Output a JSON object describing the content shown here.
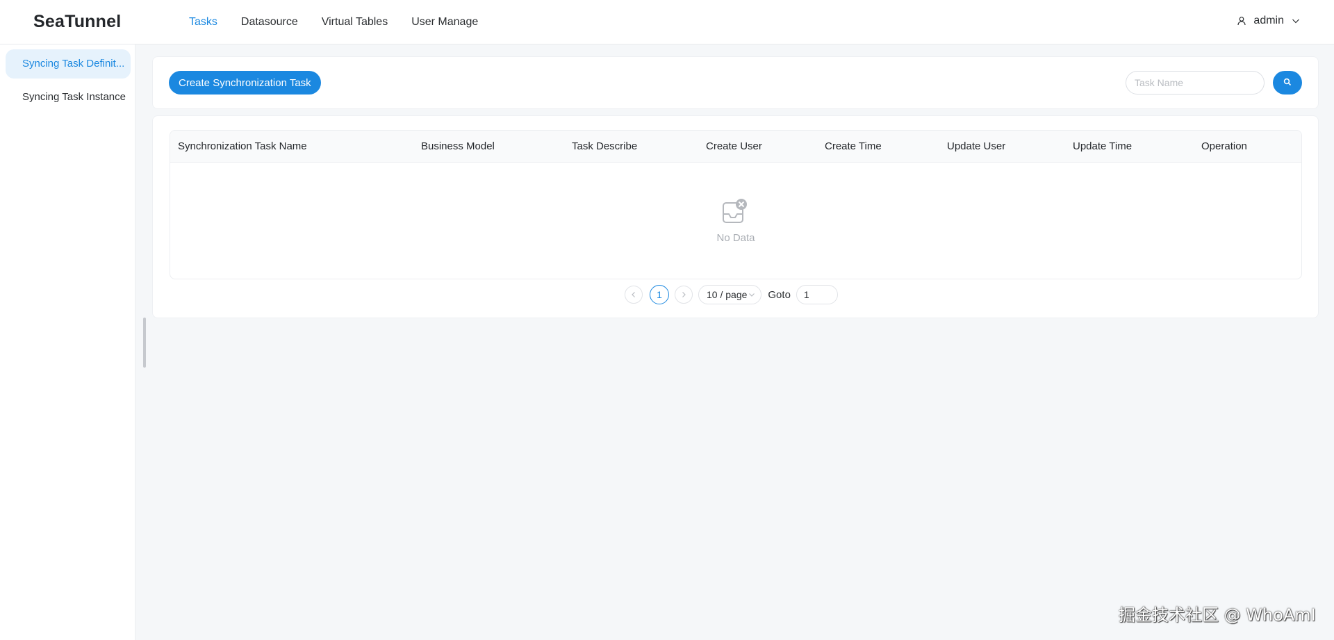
{
  "app": {
    "logo": "SeaTunnel"
  },
  "nav": {
    "items": [
      {
        "label": "Tasks",
        "active": true
      },
      {
        "label": "Datasource"
      },
      {
        "label": "Virtual Tables"
      },
      {
        "label": "User Manage"
      }
    ]
  },
  "user": {
    "name": "admin",
    "icon": "user-icon"
  },
  "sidebar": {
    "items": [
      {
        "label": "Syncing Task Definit...",
        "active": true
      },
      {
        "label": "Syncing Task Instance"
      }
    ]
  },
  "toolbar": {
    "create_label": "Create Synchronization Task",
    "search_placeholder": "Task Name",
    "search_icon": "search-icon"
  },
  "table": {
    "columns": [
      "Synchronization Task Name",
      "Business Model",
      "Task Describe",
      "Create User",
      "Create Time",
      "Update User",
      "Update Time",
      "Operation"
    ],
    "rows": [],
    "empty_text": "No Data"
  },
  "pagination": {
    "current_page": "1",
    "page_size": "10 / page",
    "goto_label": "Goto",
    "goto_value": "1"
  },
  "colors": {
    "accent": "#1b88e0",
    "background": "#f5f7f9",
    "sidebar_active_bg": "#e6f2fc"
  },
  "watermark": "掘金技术社区 @ WhoAmI"
}
